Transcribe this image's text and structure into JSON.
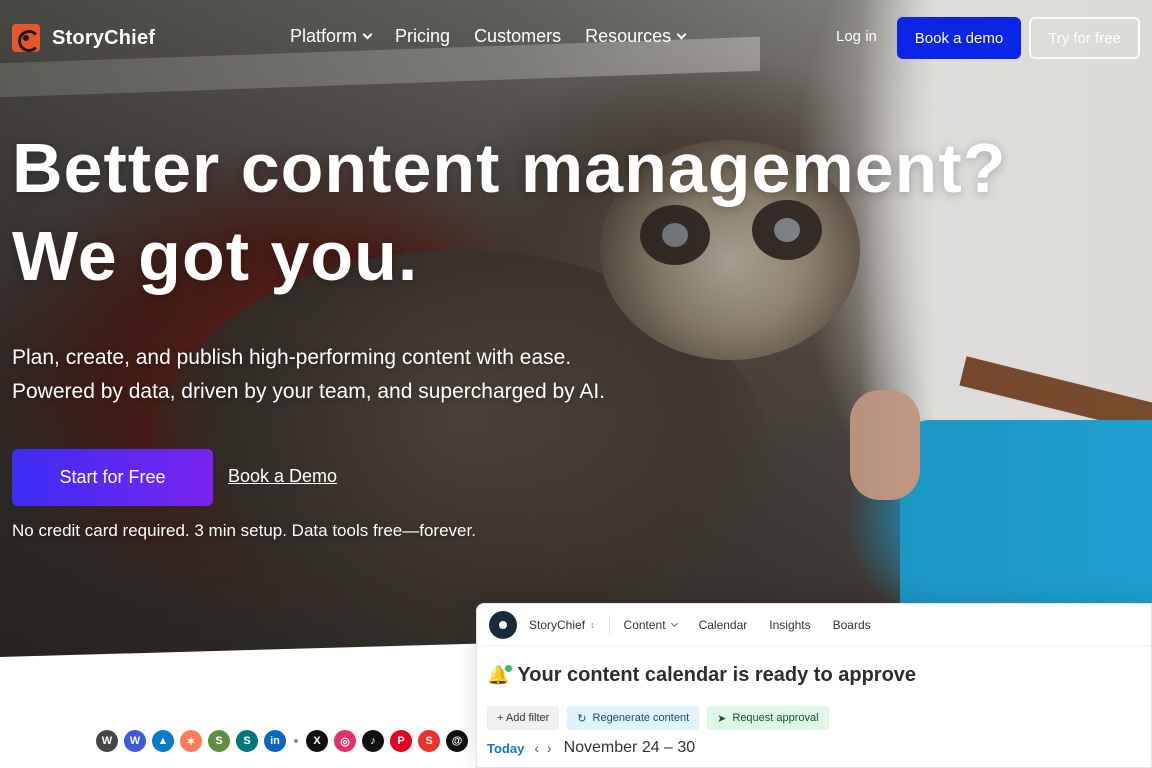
{
  "brand": {
    "name": "StoryChief",
    "accent": "#e8562a"
  },
  "nav": {
    "items": [
      {
        "label": "Platform",
        "has_dropdown": true
      },
      {
        "label": "Pricing",
        "has_dropdown": false
      },
      {
        "label": "Customers",
        "has_dropdown": false
      },
      {
        "label": "Resources",
        "has_dropdown": true
      }
    ],
    "login": "Log in",
    "book_demo": "Book a demo",
    "try_free": "Try for free"
  },
  "hero": {
    "headline_line1": "Better content management?",
    "headline_line2": "We got you.",
    "sub_line1": "Plan, create, and publish high-performing content with ease.",
    "sub_line2": "Powered by data, driven by your team, and supercharged by AI.",
    "cta_primary": "Start for Free",
    "cta_secondary": "Book a Demo",
    "note": "No credit card required. 3 min setup. Data tools free—forever."
  },
  "integrations": [
    {
      "icon": "wordpress-icon",
      "glyph": "W",
      "color": "#464646"
    },
    {
      "icon": "webflow-icon",
      "glyph": "W",
      "color": "#3b5bdb"
    },
    {
      "icon": "drupal-icon",
      "glyph": "▲",
      "color": "#0a7bc4"
    },
    {
      "icon": "hubspot-icon",
      "glyph": "✶",
      "color": "#ff7a59"
    },
    {
      "icon": "shopify-icon",
      "glyph": "S",
      "color": "#5e8e3e"
    },
    {
      "icon": "sharepoint-icon",
      "glyph": "S",
      "color": "#03787c"
    },
    {
      "icon": "linkedin-icon",
      "glyph": "in",
      "color": "#0a66c2"
    },
    {
      "icon": "x-icon",
      "glyph": "X",
      "color": "#111111"
    },
    {
      "icon": "instagram-icon",
      "glyph": "◎",
      "color": "#e1306c"
    },
    {
      "icon": "tiktok-icon",
      "glyph": "♪",
      "color": "#111111"
    },
    {
      "icon": "pinterest-icon",
      "glyph": "P",
      "color": "#e60023"
    },
    {
      "icon": "storychief-s-icon",
      "glyph": "S",
      "color": "#e8322a"
    },
    {
      "icon": "threads-icon",
      "glyph": "@",
      "color": "#111111"
    }
  ],
  "app_preview": {
    "workspace": "StoryChief",
    "tabs": [
      "Content",
      "Calendar",
      "Insights",
      "Boards"
    ],
    "title": "Your content calendar is ready to approve",
    "actions": {
      "add_filter": "+ Add filter",
      "regenerate": "Regenerate content",
      "request": "Request approval"
    },
    "today": "Today",
    "week_range": "November 24 – 30"
  }
}
